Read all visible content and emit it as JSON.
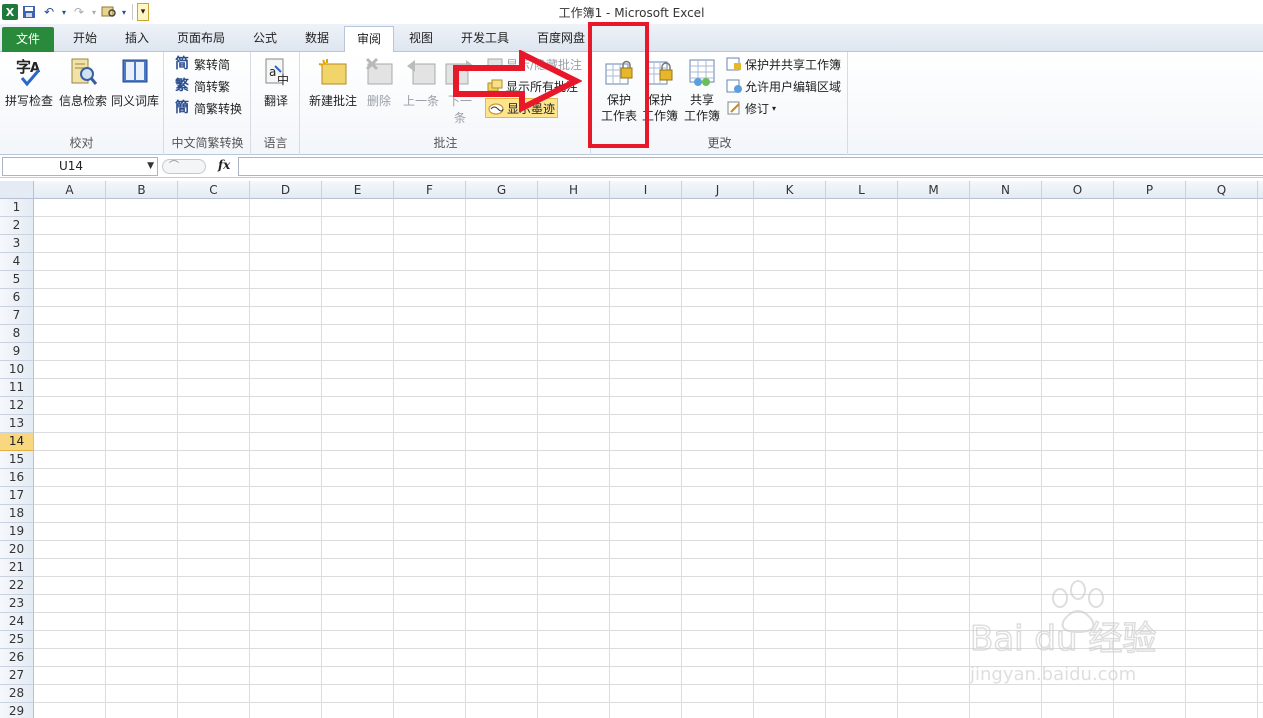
{
  "window": {
    "title": "工作簿1 - Microsoft Excel"
  },
  "qat": {
    "customize_label": "▾"
  },
  "tabs": [
    {
      "label": "文件"
    },
    {
      "label": "开始"
    },
    {
      "label": "插入"
    },
    {
      "label": "页面布局"
    },
    {
      "label": "公式"
    },
    {
      "label": "数据"
    },
    {
      "label": "审阅"
    },
    {
      "label": "视图"
    },
    {
      "label": "开发工具"
    },
    {
      "label": "百度网盘"
    }
  ],
  "ribbon": {
    "proofing": {
      "group_label": "校对",
      "spell_check": "拼写检查",
      "research": "信息检索",
      "thesaurus": "同义词库"
    },
    "chinese_conversion": {
      "group_label": "中文简繁转换",
      "to_simplified": "繁转简",
      "to_traditional": "简转繁",
      "convert": "简繁转换"
    },
    "language": {
      "group_label": "语言",
      "translate": "翻译"
    },
    "comments": {
      "group_label": "批注",
      "new_comment": "新建批注",
      "delete": "删除",
      "previous": "上一条",
      "next": "下一条",
      "hide_comment": "显示/隐藏批注",
      "show_all": "显示所有批注",
      "show_ink": "显示墨迹"
    },
    "changes": {
      "group_label": "更改",
      "protect_sheet_line1": "保护",
      "protect_sheet_line2": "工作表",
      "protect_workbook_line1": "保护",
      "protect_workbook_line2": "工作簿",
      "share_workbook_line1": "共享",
      "share_workbook_line2": "工作簿",
      "protect_share": "保护并共享工作簿",
      "allow_edit_ranges": "允许用户编辑区域",
      "track_changes": "修订"
    }
  },
  "formula_bar": {
    "name_box": "U14",
    "fx_label": "fx",
    "formula": ""
  },
  "sheet": {
    "columns": [
      "A",
      "B",
      "C",
      "D",
      "E",
      "F",
      "G",
      "H",
      "I",
      "J",
      "K",
      "L",
      "M",
      "N",
      "O",
      "P",
      "Q"
    ],
    "rows": [
      "1",
      "2",
      "3",
      "4",
      "5",
      "6",
      "7",
      "8",
      "9",
      "10",
      "11",
      "12",
      "13",
      "14",
      "15",
      "16",
      "17",
      "18",
      "19",
      "20",
      "21",
      "22",
      "23",
      "24",
      "25",
      "26",
      "27",
      "28",
      "29"
    ],
    "selected_row": "14"
  },
  "annotations": {
    "highlight_color": "#e8182b"
  },
  "watermark": {
    "brand": "Bai  du 经验",
    "url": "jingyan.baidu.com"
  }
}
